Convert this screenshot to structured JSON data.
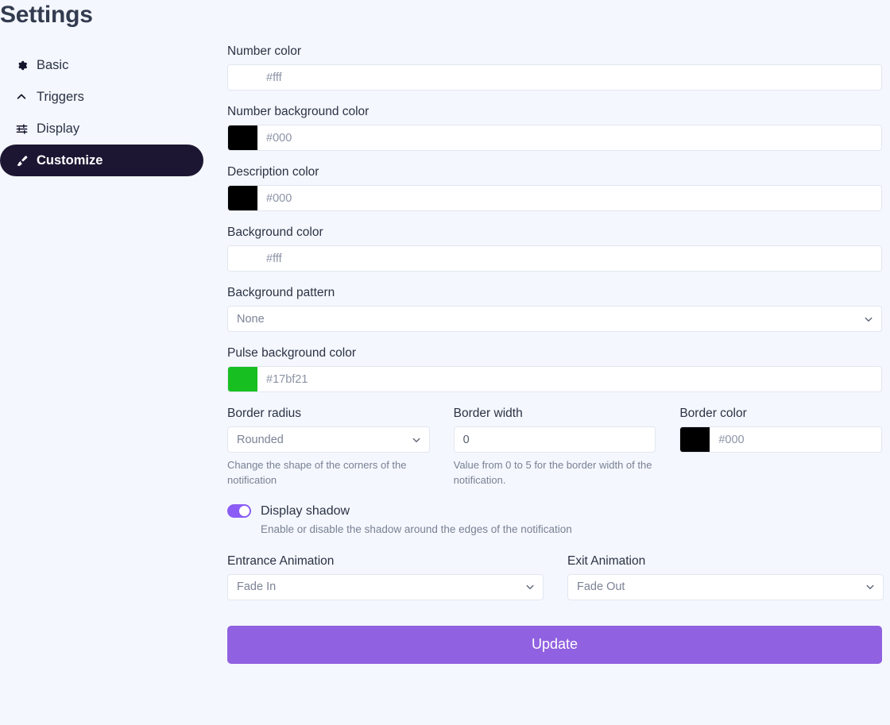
{
  "header": {
    "title": "Settings"
  },
  "sidebar": {
    "items": [
      {
        "label": "Basic",
        "icon": "gear-icon",
        "active": false
      },
      {
        "label": "Triggers",
        "icon": "chevron-up-icon",
        "active": false
      },
      {
        "label": "Display",
        "icon": "sliders-icon",
        "active": false
      },
      {
        "label": "Customize",
        "icon": "paintbrush-icon",
        "active": true
      }
    ]
  },
  "form": {
    "number_color": {
      "label": "Number color",
      "value": "#fff",
      "swatch": "#ffffff"
    },
    "number_background_color": {
      "label": "Number background color",
      "value": "#000",
      "swatch": "#000000"
    },
    "description_color": {
      "label": "Description color",
      "value": "#000",
      "swatch": "#000000"
    },
    "background_color": {
      "label": "Background color",
      "value": "#fff",
      "swatch": "#ffffff"
    },
    "background_pattern": {
      "label": "Background pattern",
      "value": "None",
      "options": [
        "None"
      ]
    },
    "pulse_background_color": {
      "label": "Pulse background color",
      "value": "#17bf21",
      "swatch": "#17bf21"
    },
    "border_radius": {
      "label": "Border radius",
      "value": "Rounded",
      "options": [
        "Rounded"
      ],
      "help": "Change the shape of the corners of the notification"
    },
    "border_width": {
      "label": "Border width",
      "value": "0",
      "help": "Value from 0 to 5 for the border width of the notification."
    },
    "border_color": {
      "label": "Border color",
      "value": "#000",
      "swatch": "#000000"
    },
    "display_shadow": {
      "label": "Display shadow",
      "enabled": true,
      "help": "Enable or disable the shadow around the edges of the notification"
    },
    "entrance_animation": {
      "label": "Entrance Animation",
      "value": "Fade In",
      "options": [
        "Fade In"
      ]
    },
    "exit_animation": {
      "label": "Exit Animation",
      "value": "Fade Out",
      "options": [
        "Fade Out"
      ]
    },
    "submit_label": "Update"
  },
  "colors": {
    "page_background": "#f4f7fd",
    "accent_purple": "#9061e0",
    "toggle_on": "#8b5cf6",
    "active_nav": "#1c1633"
  }
}
